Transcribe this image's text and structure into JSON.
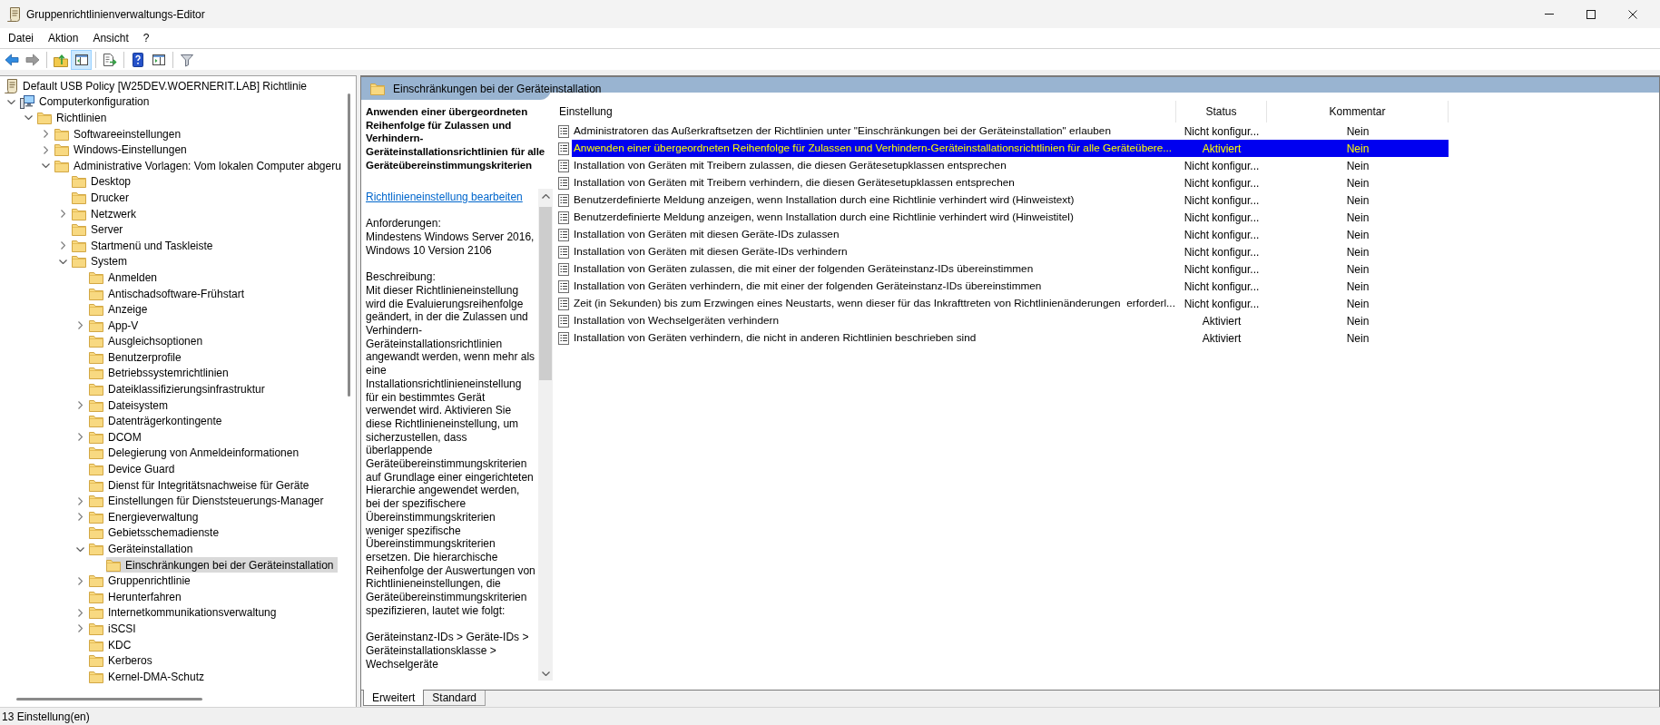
{
  "window": {
    "title": "Gruppenrichtlinienverwaltungs-Editor"
  },
  "menu": [
    "Datei",
    "Aktion",
    "Ansicht",
    "?"
  ],
  "toolbar": [
    {
      "pressed": false,
      "disabled": false
    },
    {
      "pressed": false,
      "disabled": true
    },
    {
      "pressed": false,
      "disabled": false
    },
    {
      "pressed": true,
      "disabled": false
    },
    {
      "pressed": false,
      "disabled": false
    },
    {
      "pressed": false,
      "disabled": false
    },
    {
      "pressed": false,
      "disabled": false
    },
    {
      "pressed": false,
      "disabled": false
    }
  ],
  "tree": [
    {
      "label": "Default USB Policy [W25DEV.WOERNERIT.LAB] Richtlinie",
      "kind": "policy",
      "selected": false,
      "children": [
        {
          "label": "Computerkonfiguration",
          "kind": "computer",
          "expanded": true,
          "selected": false,
          "children": [
            {
              "label": "Richtlinien",
              "kind": "folder",
              "expanded": true,
              "selected": false,
              "children": [
                {
                  "label": "Softwareeinstellungen",
                  "kind": "folder",
                  "expanded": false,
                  "selected": false
                },
                {
                  "label": "Windows-Einstellungen",
                  "kind": "folder",
                  "expanded": false,
                  "selected": false
                },
                {
                  "label": "Administrative Vorlagen: Vom lokalen Computer abgeru",
                  "kind": "folder",
                  "expanded": true,
                  "selected": false,
                  "children": [
                    {
                      "label": "Desktop",
                      "kind": "folder",
                      "selected": false
                    },
                    {
                      "label": "Drucker",
                      "kind": "folder",
                      "selected": false
                    },
                    {
                      "label": "Netzwerk",
                      "kind": "folder",
                      "expanded": false,
                      "selected": false
                    },
                    {
                      "label": "Server",
                      "kind": "folder",
                      "selected": false
                    },
                    {
                      "label": "Startmenü und Taskleiste",
                      "kind": "folder",
                      "expanded": false,
                      "selected": false
                    },
                    {
                      "label": "System",
                      "kind": "folder",
                      "expanded": true,
                      "selected": false,
                      "children": [
                        {
                          "label": "Anmelden",
                          "kind": "folder",
                          "selected": false
                        },
                        {
                          "label": "Antischadsoftware-Frühstart",
                          "kind": "folder",
                          "selected": false
                        },
                        {
                          "label": "Anzeige",
                          "kind": "folder",
                          "selected": false
                        },
                        {
                          "label": "App-V",
                          "kind": "folder",
                          "expanded": false,
                          "selected": false
                        },
                        {
                          "label": "Ausgleichsoptionen",
                          "kind": "folder",
                          "selected": false
                        },
                        {
                          "label": "Benutzerprofile",
                          "kind": "folder",
                          "selected": false
                        },
                        {
                          "label": "Betriebssystemrichtlinien",
                          "kind": "folder",
                          "selected": false
                        },
                        {
                          "label": "Dateiklassifizierungsinfrastruktur",
                          "kind": "folder",
                          "selected": false
                        },
                        {
                          "label": "Dateisystem",
                          "kind": "folder",
                          "expanded": false,
                          "selected": false
                        },
                        {
                          "label": "Datenträgerkontingente",
                          "kind": "folder",
                          "selected": false
                        },
                        {
                          "label": "DCOM",
                          "kind": "folder",
                          "expanded": false,
                          "selected": false
                        },
                        {
                          "label": "Delegierung von Anmeldeinformationen",
                          "kind": "folder",
                          "selected": false
                        },
                        {
                          "label": "Device Guard",
                          "kind": "folder",
                          "selected": false
                        },
                        {
                          "label": "Dienst für Integritätsnachweise für Geräte",
                          "kind": "folder",
                          "selected": false
                        },
                        {
                          "label": "Einstellungen für Dienststeuerungs-Manager",
                          "kind": "folder",
                          "expanded": false,
                          "selected": false
                        },
                        {
                          "label": "Energieverwaltung",
                          "kind": "folder",
                          "expanded": false,
                          "selected": false
                        },
                        {
                          "label": "Gebietsschemadienste",
                          "kind": "folder",
                          "selected": false
                        },
                        {
                          "label": "Geräteinstallation",
                          "kind": "folder",
                          "expanded": true,
                          "selected": false,
                          "children": [
                            {
                              "label": "Einschränkungen bei der Geräteinstallation",
                              "kind": "folder",
                              "selected": true
                            }
                          ]
                        },
                        {
                          "label": "Gruppenrichtlinie",
                          "kind": "folder",
                          "expanded": false,
                          "selected": false
                        },
                        {
                          "label": "Herunterfahren",
                          "kind": "folder",
                          "selected": false
                        },
                        {
                          "label": "Internetkommunikationsverwaltung",
                          "kind": "folder",
                          "expanded": false,
                          "selected": false
                        },
                        {
                          "label": "iSCSI",
                          "kind": "folder",
                          "expanded": false,
                          "selected": false
                        },
                        {
                          "label": "KDC",
                          "kind": "folder",
                          "selected": false
                        },
                        {
                          "label": "Kerberos",
                          "kind": "folder",
                          "selected": false
                        },
                        {
                          "label": "Kernel-DMA-Schutz",
                          "kind": "folder",
                          "selected": false
                        }
                      ]
                    }
                  ]
                }
              ]
            }
          ]
        }
      ]
    }
  ],
  "details": {
    "header": "Einschränkungen bei der Geräteinstallation",
    "description": {
      "title": "Anwenden einer übergeordneten Reihenfolge für Zulassen und Verhindern-Geräteinstallationsrichtlinien für alle Geräteübereinstimmungskriterien",
      "link": "Richtlinieneinstellung bearbeiten",
      "sections": [
        {
          "heading": "Anforderungen:",
          "text": "Mindestens Windows Server 2016, Windows 10 Version 2106"
        },
        {
          "heading": "Beschreibung:",
          "text": "Mit dieser Richtlinieneinstellung wird die Evaluierungsreihenfolge geändert, in der die Zulassen und Verhindern-Geräteinstallationsrichtlinien angewandt werden, wenn mehr als eine Installationsrichtlinieneinstellung für ein bestimmtes Gerät verwendet wird. Aktivieren Sie diese Richtlinieneinstellung, um sicherzustellen, dass überlappende Geräteübereinstimmungskriterien auf Grundlage einer eingerichteten Hierarchie angewendet werden, bei der spezifischere Übereinstimmungskriterien weniger spezifische Übereinstimmungskriterien ersetzen. Die hierarchische Reihenfolge der Auswertungen von Richtlinieneinstellungen, die Geräteübereinstimmungskriterien spezifizieren, lautet wie folgt:"
        },
        {
          "text": "Geräteinstanz-IDs > Geräte-IDs > Geräteinstallationsklasse > Wechselgeräte"
        }
      ]
    }
  },
  "list": {
    "columns": [
      "Einstellung",
      "Status",
      "Kommentar"
    ],
    "rows": [
      {
        "setting": "Administratoren das Außerkraftsetzen der Richtlinien unter \"Einschränkungen bei der Geräteinstallation\" erlauben",
        "status": "Nicht konfigur...",
        "comment": "Nein",
        "selected": false
      },
      {
        "setting": "Anwenden einer übergeordneten Reihenfolge für Zulassen und Verhindern-Geräteinstallationsrichtlinien für alle Geräteübere...",
        "status": "Aktiviert",
        "comment": "Nein",
        "selected": true
      },
      {
        "setting": "Installation von Geräten mit Treibern zulassen, die diesen Gerätesetupklassen entsprechen",
        "status": "Nicht konfigur...",
        "comment": "Nein",
        "selected": false
      },
      {
        "setting": "Installation von Geräten mit Treibern verhindern, die diesen Gerätesetupklassen entsprechen",
        "status": "Nicht konfigur...",
        "comment": "Nein",
        "selected": false
      },
      {
        "setting": "Benutzerdefinierte Meldung anzeigen, wenn Installation durch eine Richtlinie verhindert wird (Hinweistext)",
        "status": "Nicht konfigur...",
        "comment": "Nein",
        "selected": false
      },
      {
        "setting": "Benutzerdefinierte Meldung anzeigen, wenn Installation durch eine Richtlinie verhindert wird (Hinweistitel)",
        "status": "Nicht konfigur...",
        "comment": "Nein",
        "selected": false
      },
      {
        "setting": "Installation von Geräten mit diesen Geräte-IDs zulassen",
        "status": "Nicht konfigur...",
        "comment": "Nein",
        "selected": false
      },
      {
        "setting": "Installation von Geräten mit diesen Geräte-IDs verhindern",
        "status": "Nicht konfigur...",
        "comment": "Nein",
        "selected": false
      },
      {
        "setting": "Installation von Geräten zulassen, die mit einer der folgenden Geräteinstanz-IDs übereinstimmen",
        "status": "Nicht konfigur...",
        "comment": "Nein",
        "selected": false
      },
      {
        "setting": "Installation von Geräten verhindern, die mit einer der folgenden Geräteinstanz-IDs übereinstimmen",
        "status": "Nicht konfigur...",
        "comment": "Nein",
        "selected": false
      },
      {
        "setting": "Zeit (in Sekunden) bis zum Erzwingen eines Neustarts, wenn dieser für das Inkrafttreten von Richtlinienänderungen  erforderl...",
        "status": "Nicht konfigur...",
        "comment": "Nein",
        "selected": false
      },
      {
        "setting": "Installation von Wechselgeräten verhindern",
        "status": "Aktiviert",
        "comment": "Nein",
        "selected": false
      },
      {
        "setting": "Installation von Geräten verhindern, die nicht in anderen Richtlinien beschrieben sind",
        "status": "Aktiviert",
        "comment": "Nein",
        "selected": false
      }
    ]
  },
  "bottom_tabs": [
    {
      "label": "Erweitert",
      "selected": true
    },
    {
      "label": "Standard",
      "selected": false
    }
  ],
  "status_bar": "13 Einstellung(en)"
}
